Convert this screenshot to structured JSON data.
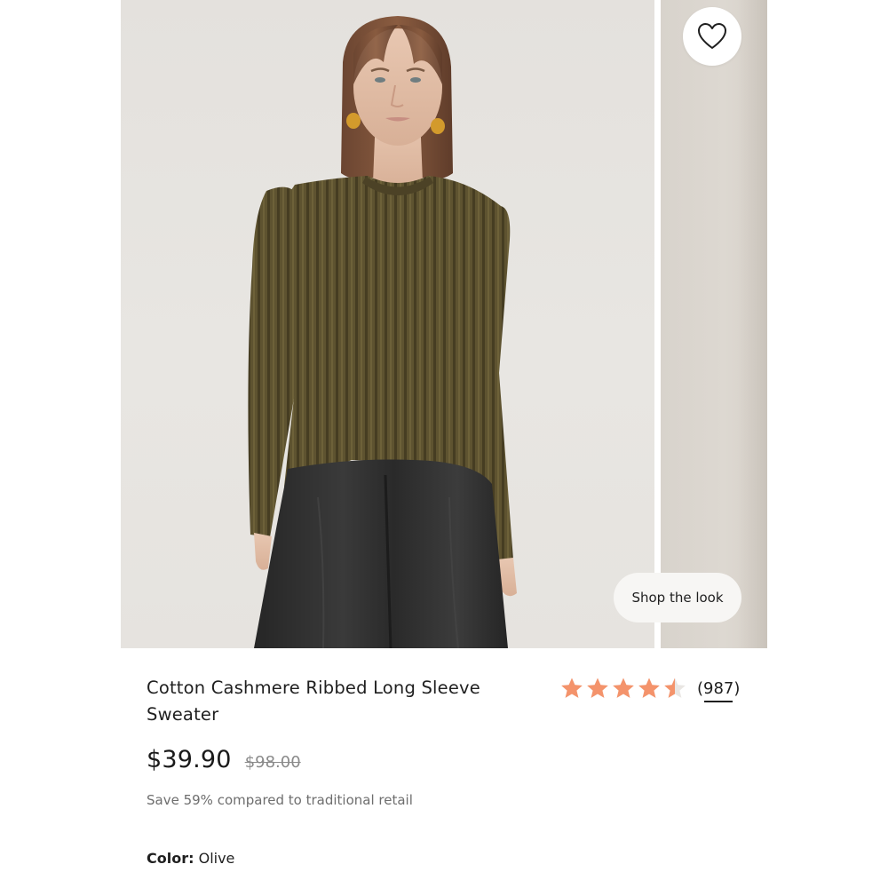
{
  "gallery": {
    "main_image_alt": "",
    "shop_the_look_label": "Shop the look",
    "wishlist_icon": "heart-outline-icon"
  },
  "product": {
    "title": "Cotton Cashmere Ribbed Long Sleeve Sweater",
    "rating": 4.5,
    "review_count": "(987)",
    "star_color": "#f4936b",
    "price": "$39.90",
    "original_price": "$98.00",
    "savings_note": "Save 59% compared to traditional retail",
    "color_label": "Color:",
    "color_value": "Olive"
  }
}
